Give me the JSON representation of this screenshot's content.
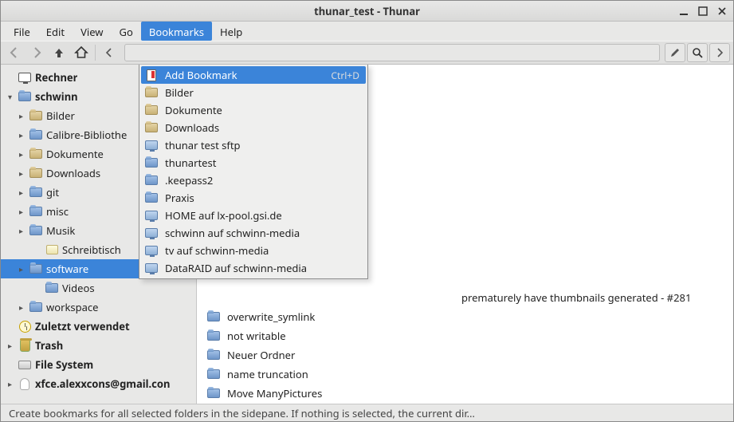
{
  "window": {
    "title": "thunar_test - Thunar"
  },
  "menubar": {
    "items": [
      "File",
      "Edit",
      "View",
      "Go",
      "Bookmarks",
      "Help"
    ],
    "active_index": 4
  },
  "toolbar": {
    "buttons": {
      "back": "go-back-icon",
      "forward": "go-forward-icon",
      "up": "go-up-icon",
      "home": "go-home-icon"
    }
  },
  "dropdown": {
    "items": [
      {
        "icon": "bookmark-new-icon",
        "label": "Add Bookmark",
        "accel": "Ctrl+D",
        "highlight": true
      },
      {
        "icon": "folder-tan-icon",
        "label": "Bilder"
      },
      {
        "icon": "folder-tan-icon",
        "label": "Dokumente"
      },
      {
        "icon": "folder-tan-icon",
        "label": "Downloads"
      },
      {
        "icon": "network-icon",
        "label": "thunar test sftp"
      },
      {
        "icon": "folder-blue-icon",
        "label": "thunartest"
      },
      {
        "icon": "folder-blue-icon",
        "label": ".keepass2"
      },
      {
        "icon": "folder-blue-icon",
        "label": "Praxis"
      },
      {
        "icon": "network-icon",
        "label": "HOME auf lx-pool.gsi.de"
      },
      {
        "icon": "network-icon",
        "label": "schwinn auf schwinn-media"
      },
      {
        "icon": "network-icon",
        "label": "tv auf schwinn-media"
      },
      {
        "icon": "network-icon",
        "label": "DataRAID auf schwinn-media"
      }
    ]
  },
  "sidepane": {
    "nodes": [
      {
        "depth": 0,
        "icon": "monitor-icon",
        "label": "Rechner",
        "bold": true,
        "expander": "none"
      },
      {
        "depth": 0,
        "icon": "folder-blue-icon",
        "label": "schwinn",
        "bold": true,
        "expander": "open",
        "selected": false
      },
      {
        "depth": 1,
        "icon": "folder-tan-icon",
        "label": "Bilder",
        "expander": "closed"
      },
      {
        "depth": 1,
        "icon": "folder-blue-icon",
        "label": "Calibre-Bibliothek",
        "expander": "closed",
        "truncate": "Calibre-Bibliothe"
      },
      {
        "depth": 1,
        "icon": "folder-tan-icon",
        "label": "Dokumente",
        "expander": "closed"
      },
      {
        "depth": 1,
        "icon": "folder-tan-icon",
        "label": "Downloads",
        "expander": "closed"
      },
      {
        "depth": 1,
        "icon": "folder-blue-icon",
        "label": "git",
        "expander": "closed"
      },
      {
        "depth": 1,
        "icon": "folder-blue-icon",
        "label": "misc",
        "expander": "closed"
      },
      {
        "depth": 1,
        "icon": "folder-blue-icon",
        "label": "Musik",
        "expander": "closed"
      },
      {
        "depth": 2,
        "icon": "desktop-icon",
        "label": "Schreibtisch",
        "expander": "none"
      },
      {
        "depth": 1,
        "icon": "folder-blue-icon",
        "label": "software",
        "expander": "closed",
        "selected": true
      },
      {
        "depth": 2,
        "icon": "folder-blue-icon",
        "label": "Videos",
        "expander": "none"
      },
      {
        "depth": 1,
        "icon": "folder-blue-icon",
        "label": "workspace",
        "expander": "closed"
      },
      {
        "depth": 0,
        "icon": "clock-icon",
        "label": "Zuletzt verwendet",
        "bold": true,
        "expander": "none"
      },
      {
        "depth": 0,
        "icon": "trash-icon",
        "label": "Trash",
        "bold": true,
        "expander": "closed"
      },
      {
        "depth": 0,
        "icon": "drive-icon",
        "label": "File System",
        "bold": true,
        "expander": "none"
      },
      {
        "depth": 0,
        "icon": "ghost-icon",
        "label": "xfce.alexxcons@gmail.com",
        "bold": true,
        "expander": "closed",
        "truncate": "xfce.alexxcons@gmail.con"
      }
    ]
  },
  "filelist": {
    "visible_tail_of_row": "prematurely have thumbnails generated - #281",
    "rows": [
      {
        "icon": "folder-blue-icon",
        "label": "overwrite_symlink"
      },
      {
        "icon": "folder-blue-icon",
        "label": "not writable"
      },
      {
        "icon": "folder-blue-icon",
        "label": "Neuer Ordner"
      },
      {
        "icon": "folder-blue-icon",
        "label": "name truncation"
      },
      {
        "icon": "folder-blue-icon",
        "label": "Move ManyPictures"
      }
    ]
  },
  "statusbar": {
    "text": "Create bookmarks for all selected folders in the sidepane. If nothing is selected, the current dir…"
  }
}
